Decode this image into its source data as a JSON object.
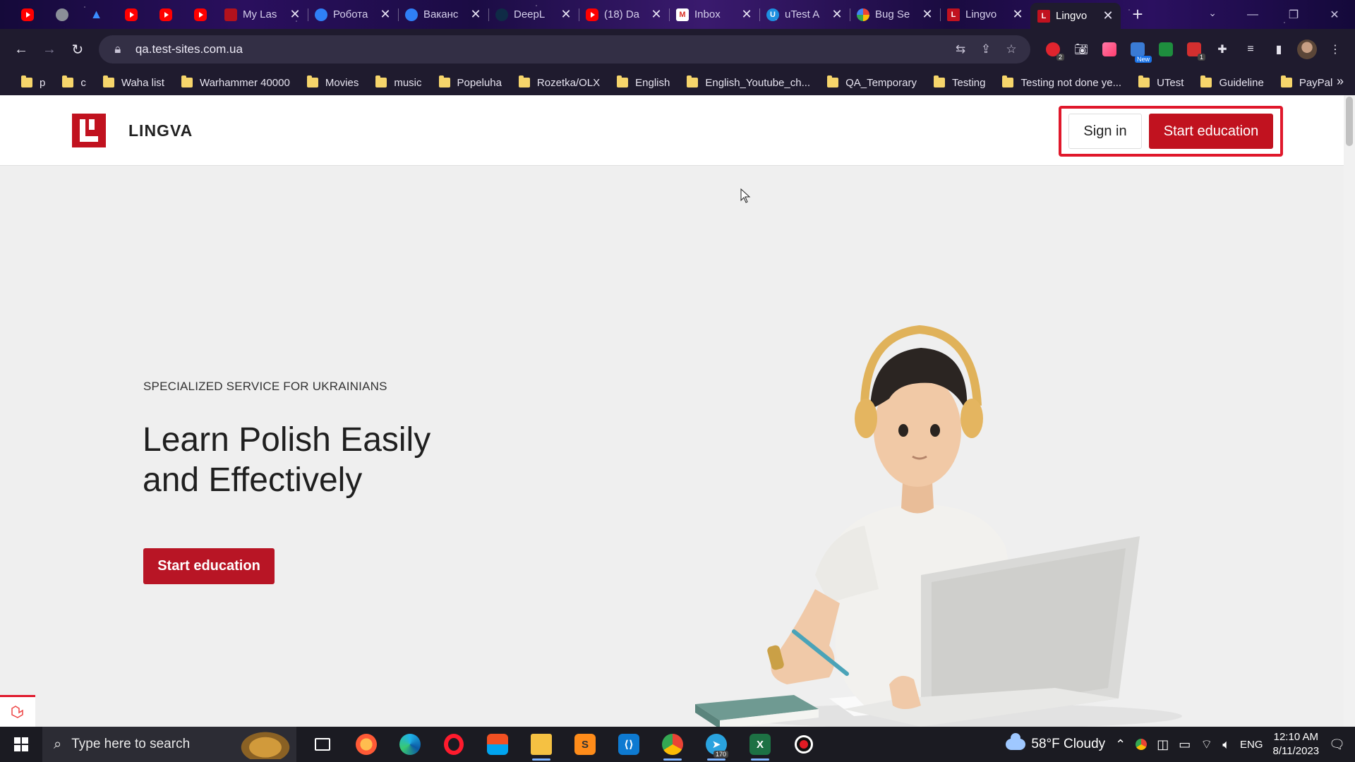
{
  "browser": {
    "tabs": [
      {
        "title": "My Las",
        "icon": "red-app-icon"
      },
      {
        "title": "Робота",
        "icon": "blue-circle-icon"
      },
      {
        "title": "Ваканс",
        "icon": "blue-circle-icon"
      },
      {
        "title": "DeepL",
        "icon": "deepl-icon"
      },
      {
        "title": "(18) Da",
        "icon": "youtube-icon"
      },
      {
        "title": "Inbox",
        "icon": "gmail-icon"
      },
      {
        "title": "uTest A",
        "icon": "utest-icon"
      },
      {
        "title": "Bug Se",
        "icon": "google-icon"
      },
      {
        "title": "Lingvo",
        "icon": "lingva-icon"
      },
      {
        "title": "Lingvo",
        "icon": "lingva-icon",
        "active": true
      }
    ],
    "url": "qa.test-sites.com.ua",
    "new_tab_label": "+",
    "extensions": {
      "badge_counts": [
        "2",
        "1"
      ],
      "new_badge": "New"
    },
    "bookmarks": [
      "p",
      "c",
      "Waha list",
      "Warhammer 40000",
      "Movies",
      "music",
      "Popeluha",
      "Rozetka/OLX",
      "English",
      "English_Youtube_ch...",
      "QA_Temporary",
      "Testing",
      "Testing not done ye...",
      "UTest",
      "Guideline",
      "PayPal"
    ],
    "bookmarks_more": "»"
  },
  "site": {
    "logo_text": "LINGVA",
    "sign_in_label": "Sign in",
    "start_education_header_label": "Start education",
    "hero": {
      "eyebrow": "SPECIALIZED SERVICE FOR UKRAINIANS",
      "title_line1": "Learn Polish Easily",
      "title_line2": "and Effectively",
      "cta_label": "Start education"
    },
    "accent_color": "#c1121f",
    "highlight_color": "#e0182b"
  },
  "taskbar": {
    "search_placeholder": "Type here to search",
    "telegram_badge": "170",
    "weather": "58°F  Cloudy",
    "language": "ENG",
    "time": "12:10 AM",
    "date": "8/11/2023"
  }
}
